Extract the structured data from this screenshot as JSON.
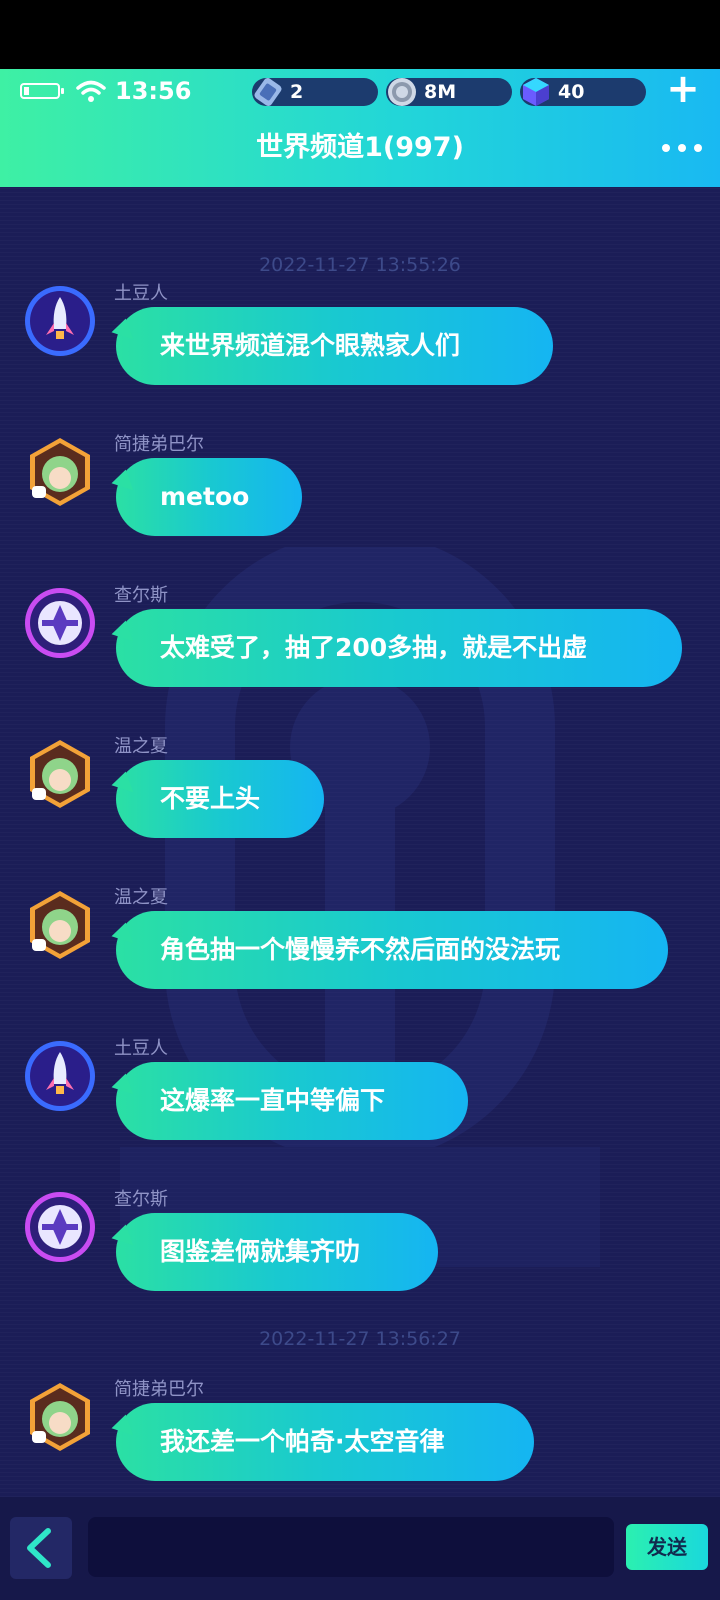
{
  "status_bar": {
    "time": "13:56"
  },
  "resources": [
    {
      "icon": "ticket-icon",
      "value": "2"
    },
    {
      "icon": "coin-icon",
      "value": "8M"
    },
    {
      "icon": "gem-cube-icon",
      "value": "40"
    }
  ],
  "header": {
    "title": "世界频道1(997)",
    "add_label": "+"
  },
  "chat": {
    "timestamps": [
      "2022-11-27 13:55:26",
      "2022-11-27 13:56:27"
    ],
    "messages": [
      {
        "user": "土豆人",
        "text": "来世界频道混个眼熟家人们",
        "avatar": "rocket-avatar"
      },
      {
        "user": "简捷弟巴尔",
        "text": "metoo",
        "avatar": "green-hair-girl-avatar"
      },
      {
        "user": "查尔斯",
        "text": "太难受了，抽了200多抽，就是不出虚",
        "avatar": "emblem-avatar"
      },
      {
        "user": "温之夏",
        "text": "不要上头",
        "avatar": "green-hair-girl-avatar"
      },
      {
        "user": "温之夏",
        "text": "角色抽一个慢慢养不然后面的没法玩",
        "avatar": "green-hair-girl-avatar"
      },
      {
        "user": "土豆人",
        "text": "这爆率一直中等偏下",
        "avatar": "rocket-avatar"
      },
      {
        "user": "查尔斯",
        "text": "图鉴差俩就集齐叻",
        "avatar": "emblem-avatar"
      },
      {
        "user": "简捷弟巴尔",
        "text": "我还差一个帕奇·太空音律",
        "avatar": "green-hair-girl-avatar"
      }
    ]
  },
  "composer": {
    "placeholder": "",
    "send_label": "发送"
  },
  "colors": {
    "header_gradient_start": "#3ef0a4",
    "header_gradient_end": "#19b9f2",
    "chat_background": "#1b1d57",
    "bubble_start": "#2be0a4",
    "bubble_end": "#15b5f2"
  }
}
